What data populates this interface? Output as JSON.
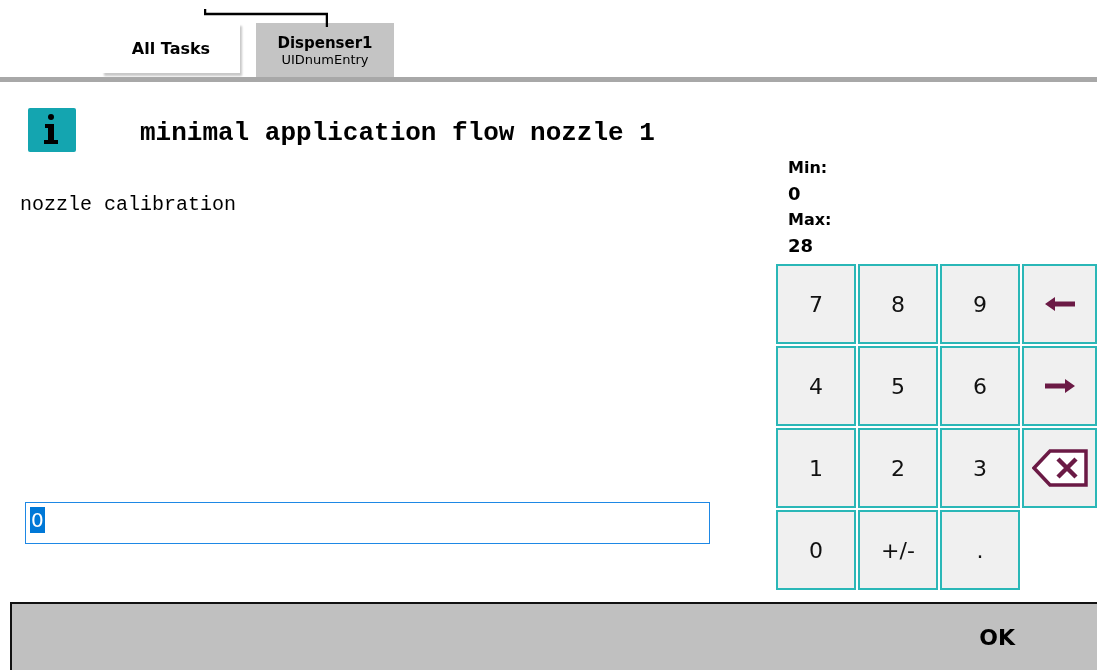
{
  "tabs": [
    {
      "title": "All Tasks",
      "selected": false
    },
    {
      "title": "Dispenser1",
      "subtitle": "UIDnumEntry",
      "selected": true
    }
  ],
  "dialog": {
    "title": "minimal application flow nozzle 1",
    "description": "nozzle calibration",
    "limits": [
      {
        "label": "Min:",
        "value": "0"
      },
      {
        "label": "Max:",
        "value": "28"
      }
    ],
    "input": {
      "value": "0",
      "value_selected": true
    },
    "keypad": [
      {
        "kind": "text",
        "label": "7"
      },
      {
        "kind": "text",
        "label": "8"
      },
      {
        "kind": "text",
        "label": "9"
      },
      {
        "kind": "arrow-left"
      },
      {
        "kind": "text",
        "label": "4"
      },
      {
        "kind": "text",
        "label": "5"
      },
      {
        "kind": "text",
        "label": "6"
      },
      {
        "kind": "arrow-right"
      },
      {
        "kind": "text",
        "label": "1"
      },
      {
        "kind": "text",
        "label": "2"
      },
      {
        "kind": "text",
        "label": "3"
      },
      {
        "kind": "backspace"
      },
      {
        "kind": "text",
        "label": "0"
      },
      {
        "kind": "text",
        "label": "+/-"
      },
      {
        "kind": "text",
        "label": "."
      }
    ]
  },
  "buttons": [
    {
      "label": "OK"
    }
  ]
}
